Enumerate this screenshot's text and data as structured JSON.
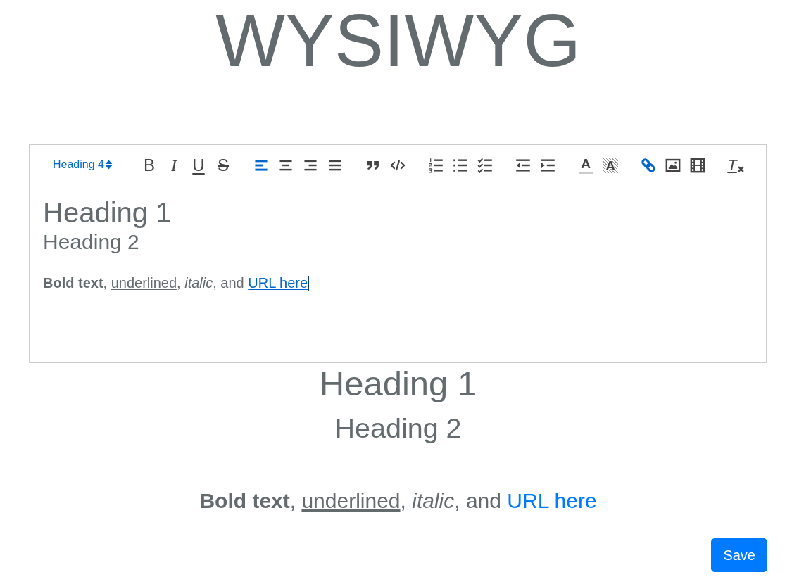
{
  "title": "WYSIWYG",
  "editor": {
    "toolbar": {
      "heading_picker": {
        "label": "Heading 4"
      },
      "groups": [
        {
          "tools": [
            {
              "kind": "bold",
              "glyph": "B",
              "active": false
            },
            {
              "kind": "italic",
              "glyph": "I",
              "active": false
            },
            {
              "kind": "underline",
              "glyph": "U",
              "active": false
            },
            {
              "kind": "strike",
              "glyph": "S",
              "active": false
            }
          ]
        },
        {
          "tools": [
            {
              "kind": "align_left",
              "active": true
            },
            {
              "kind": "align_center",
              "active": false
            },
            {
              "kind": "align_right",
              "active": false
            },
            {
              "kind": "justify",
              "active": false
            }
          ]
        },
        {
          "tools": [
            {
              "kind": "blockquote",
              "active": false
            },
            {
              "kind": "code_block",
              "active": false
            }
          ]
        },
        {
          "tools": [
            {
              "kind": "ordered_list",
              "active": false
            },
            {
              "kind": "bullet_list",
              "active": false
            },
            {
              "kind": "check_list",
              "active": false
            }
          ]
        },
        {
          "tools": [
            {
              "kind": "outdent",
              "active": false
            },
            {
              "kind": "indent",
              "active": false
            }
          ]
        },
        {
          "tools": [
            {
              "kind": "font_color",
              "glyph": "A",
              "active": false
            },
            {
              "kind": "background_color",
              "glyph": "A",
              "active": false
            }
          ]
        },
        {
          "tools": [
            {
              "kind": "link",
              "active": true
            },
            {
              "kind": "image",
              "active": false
            },
            {
              "kind": "video",
              "active": false
            }
          ]
        },
        {
          "tools": [
            {
              "kind": "clean",
              "glyph": "T",
              "active": false
            }
          ]
        }
      ]
    },
    "content": {
      "heading_1": "Heading 1",
      "heading_2": "Heading 2",
      "paragraph": [
        {
          "kind": "bold",
          "text": "Bold text"
        },
        {
          "kind": "plain",
          "text": ", "
        },
        {
          "kind": "underline",
          "text": "underlined"
        },
        {
          "kind": "plain",
          "text": ", "
        },
        {
          "kind": "italic",
          "text": "italic"
        },
        {
          "kind": "plain",
          "text": ", and "
        },
        {
          "kind": "link",
          "text": "URL here"
        }
      ],
      "caret": true
    }
  },
  "preview": {
    "heading_1": "Heading 1",
    "heading_2": "Heading 2",
    "paragraph": [
      {
        "kind": "bold",
        "text": "Bold text"
      },
      {
        "kind": "plain",
        "text": ", "
      },
      {
        "kind": "underline",
        "text": "underlined"
      },
      {
        "kind": "plain",
        "text": ", "
      },
      {
        "kind": "italic",
        "text": "italic"
      },
      {
        "kind": "plain",
        "text": ", and "
      },
      {
        "kind": "link",
        "text": "URL here"
      }
    ]
  },
  "save_button": {
    "label": "Save"
  }
}
